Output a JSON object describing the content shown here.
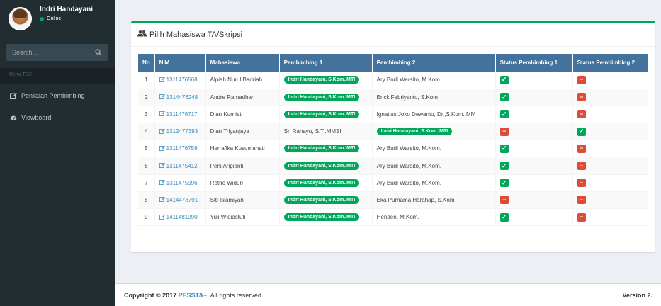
{
  "user": {
    "name": "Indri Handayani",
    "status": "Online"
  },
  "search": {
    "placeholder": "Search..."
  },
  "menu": {
    "header": "Menu TG2",
    "items": [
      {
        "label": "Penilaian Pembimbing",
        "icon": "edit-icon"
      },
      {
        "label": "Viewboard",
        "icon": "dashboard-icon"
      }
    ]
  },
  "box": {
    "title": "Pilih Mahasiswa TA/Skripsi"
  },
  "table": {
    "headers": [
      "No",
      "NIM",
      "Mahasiswa",
      "Pembimbing 1",
      "Pembimbing 2",
      "Status Pembimbing 1",
      "Status Pembimbing 2"
    ],
    "rows": [
      {
        "no": "1",
        "nim": "1311476568",
        "mahasiswa": "Alpiah Nurul Badriah",
        "p1": "Indri Handayani, S.Kom.,MTI",
        "p1_badge": true,
        "p2": "Ary Budi Warsito, M.Kom.",
        "p2_badge": false,
        "s1": "ok",
        "s2": "no"
      },
      {
        "no": "2",
        "nim": "1314476248",
        "mahasiswa": "Andre Ramadhan",
        "p1": "Indri Handayani, S.Kom.,MTI",
        "p1_badge": true,
        "p2": "Erick Febriyanto, S.Kom",
        "p2_badge": false,
        "s1": "ok",
        "s2": "no"
      },
      {
        "no": "3",
        "nim": "1311476717",
        "mahasiswa": "Dian Kurniati",
        "p1": "Indri Handayani, S.Kom.,MTI",
        "p1_badge": true,
        "p2": "Ignatius Joko Dewanto, Dr.,S.Kom.,MM",
        "p2_badge": false,
        "s1": "ok",
        "s2": "no"
      },
      {
        "no": "4",
        "nim": "1312477393",
        "mahasiswa": "Dian Triyanjaya",
        "p1": "Sri Rahayu, S.T,.MMSI",
        "p1_badge": false,
        "p2": "Indri Handayani, S.Kom.,MTI",
        "p2_badge": true,
        "s1": "no",
        "s2": "ok"
      },
      {
        "no": "5",
        "nim": "1311476759",
        "mahasiswa": "Herrafika Kusumahati",
        "p1": "Indri Handayani, S.Kom.,MTI",
        "p1_badge": true,
        "p2": "Ary Budi Warsito, M.Kom.",
        "p2_badge": false,
        "s1": "ok",
        "s2": "no"
      },
      {
        "no": "6",
        "nim": "1311475412",
        "mahasiswa": "Peni Aripianti",
        "p1": "Indri Handayani, S.Kom.,MTI",
        "p1_badge": true,
        "p2": "Ary Budi Warsito, M.Kom.",
        "p2_badge": false,
        "s1": "ok",
        "s2": "no"
      },
      {
        "no": "7",
        "nim": "1311475996",
        "mahasiswa": "Retno Widuri",
        "p1": "Indri Handayani, S.Kom.,MTI",
        "p1_badge": true,
        "p2": "Ary Budi Warsito, M.Kom.",
        "p2_badge": false,
        "s1": "ok",
        "s2": "no"
      },
      {
        "no": "8",
        "nim": "1414478791",
        "mahasiswa": "Siti Islamiyah",
        "p1": "Indri Handayani, S.Kom.,MTI",
        "p1_badge": true,
        "p2": "Eka Purnama Harahap, S.Kom",
        "p2_badge": false,
        "s1": "no",
        "s2": "no"
      },
      {
        "no": "9",
        "nim": "1411481990",
        "mahasiswa": "Yuli Widiastuti",
        "p1": "Indri Handayani, S.Kom.,MTI",
        "p1_badge": true,
        "p2": "Henderi, M.Kom.",
        "p2_badge": false,
        "s1": "ok",
        "s2": "no"
      }
    ]
  },
  "footer": {
    "copyright_prefix": "Copyright © 2017",
    "brand": "PESSTA+.",
    "suffix": "All rights reserved.",
    "version": "Version 2."
  },
  "colors": {
    "accent": "#3c8dbc",
    "success": "#00a65a",
    "danger": "#dd4b39",
    "sidebar": "#222d32"
  }
}
